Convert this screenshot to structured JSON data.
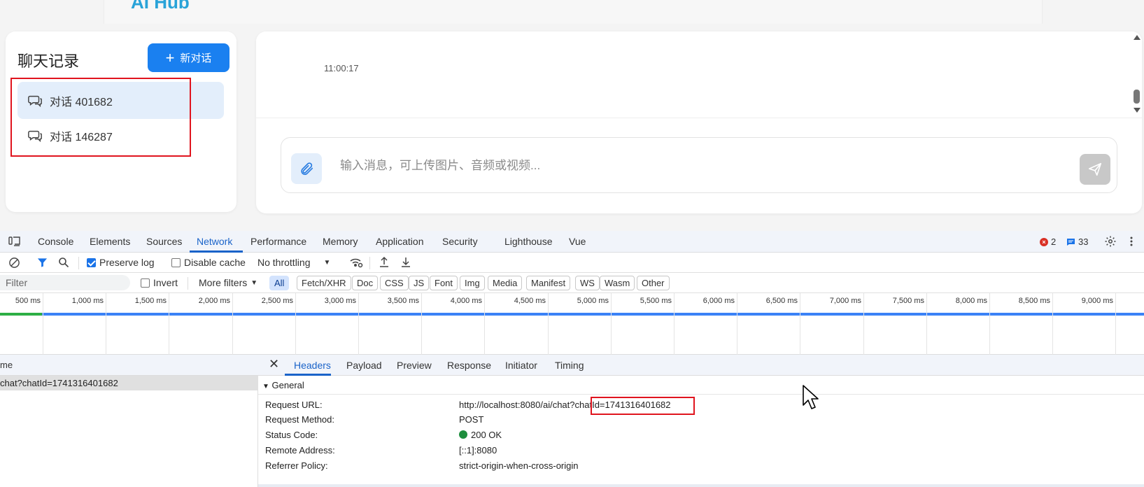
{
  "app": {
    "brand": "AI Hub",
    "history": {
      "title": "聊天记录",
      "new_button": "新对话",
      "items": [
        {
          "label": "对话 401682",
          "active": true
        },
        {
          "label": "对话 146287",
          "active": false
        }
      ]
    },
    "chat": {
      "timestamp": "11:00:17",
      "input_placeholder": "输入消息，可上传图片、音频或视频..."
    }
  },
  "devtools": {
    "tabs": [
      "Console",
      "Elements",
      "Sources",
      "Network",
      "Performance",
      "Memory",
      "Application",
      "Security",
      "Lighthouse",
      "Vue"
    ],
    "active_tab": "Network",
    "error_count": "2",
    "message_count": "33",
    "toolbar": {
      "preserve_log": "Preserve log",
      "disable_cache": "Disable cache",
      "throttling": "No throttling"
    },
    "filterbar": {
      "filter_placeholder": "Filter",
      "invert": "Invert",
      "more_filters": "More filters",
      "chips": [
        "All",
        "Fetch/XHR",
        "Doc",
        "CSS",
        "JS",
        "Font",
        "Img",
        "Media",
        "Manifest",
        "WS",
        "Wasm",
        "Other"
      ]
    },
    "timeline_ticks": [
      "500 ms",
      "1,000 ms",
      "1,500 ms",
      "2,000 ms",
      "2,500 ms",
      "3,000 ms",
      "3,500 ms",
      "4,000 ms",
      "4,500 ms",
      "5,000 ms",
      "5,500 ms",
      "6,000 ms",
      "6,500 ms",
      "7,000 ms",
      "7,500 ms",
      "8,000 ms",
      "8,500 ms",
      "9,000 ms"
    ],
    "request_list": {
      "header": "me",
      "rows": [
        "chat?chatId=1741316401682"
      ]
    },
    "detail": {
      "tabs": [
        "Headers",
        "Payload",
        "Preview",
        "Response",
        "Initiator",
        "Timing"
      ],
      "active_tab": "Headers",
      "section": "General",
      "headers": [
        {
          "name": "Request URL:",
          "value": "http://localhost:8080/ai/chat?chatId=1741316401682"
        },
        {
          "name": "Request Method:",
          "value": "POST"
        },
        {
          "name": "Status Code:",
          "value": "200 OK"
        },
        {
          "name": "Remote Address:",
          "value": "[::1]:8080"
        },
        {
          "name": "Referrer Policy:",
          "value": "strict-origin-when-cross-origin"
        }
      ],
      "url_prefix": "http://localhost:8080/ai/chat?",
      "url_highlight": "chatId=1741316401682"
    }
  },
  "colors": {
    "primary": "#1a80f0",
    "active_tab": "#1a63c9",
    "highlight_border": "#e0141e",
    "status_ok": "#1e8e3e"
  }
}
